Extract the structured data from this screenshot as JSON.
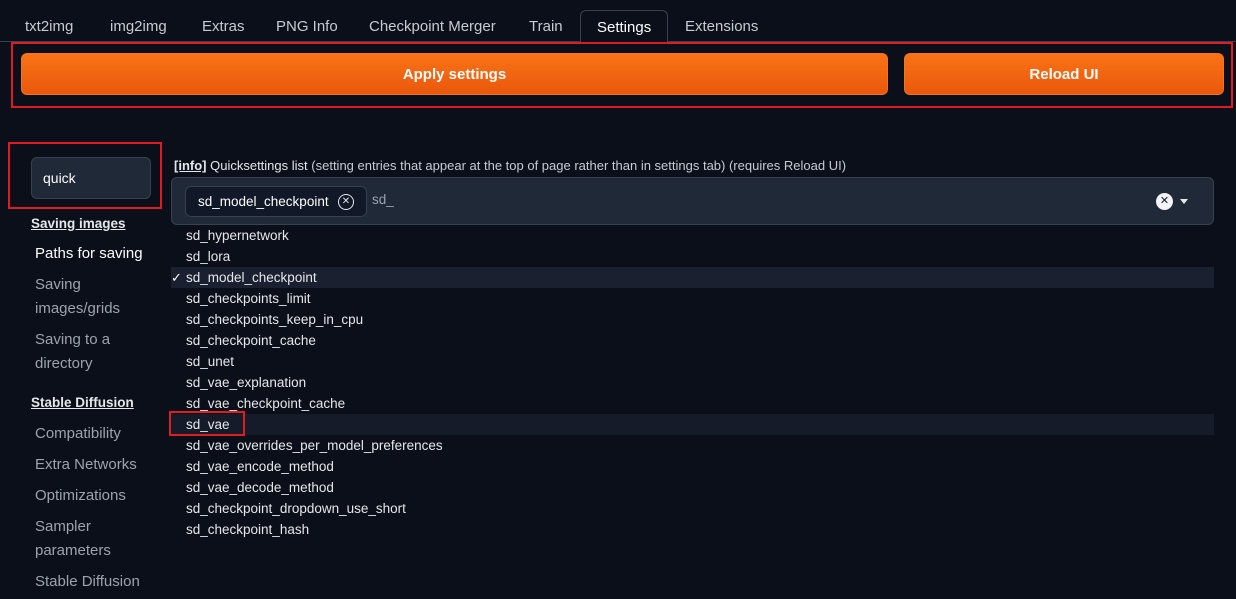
{
  "tabs": [
    "txt2img",
    "img2img",
    "Extras",
    "PNG Info",
    "Checkpoint Merger",
    "Train",
    "Settings",
    "Extensions"
  ],
  "active_tab": "Settings",
  "actions": {
    "apply": "Apply settings",
    "reload": "Reload UI"
  },
  "search": {
    "value": "quick"
  },
  "sidebar": {
    "saving_heading": "Saving images",
    "saving_items": [
      "Paths for saving",
      "Saving images/grids",
      "Saving to a directory"
    ],
    "sd_heading": "Stable Diffusion",
    "sd_items": [
      "Compatibility",
      "Extra Networks",
      "Optimizations",
      "Sampler parameters",
      "Stable Diffusion"
    ]
  },
  "setting": {
    "info_tag": "[info]",
    "label": "Quicksettings list",
    "description": " (setting entries that appear at the top of page rather than in settings tab) (requires Reload UI)",
    "chip": "sd_model_checkpoint",
    "input_value": "sd_",
    "options": [
      "sd_hypernetwork",
      "sd_lora",
      "sd_model_checkpoint",
      "sd_checkpoints_limit",
      "sd_checkpoints_keep_in_cpu",
      "sd_checkpoint_cache",
      "sd_unet",
      "sd_vae_explanation",
      "sd_vae_checkpoint_cache",
      "sd_vae",
      "sd_vae_overrides_per_model_preferences",
      "sd_vae_encode_method",
      "sd_vae_decode_method",
      "sd_checkpoint_dropdown_use_short",
      "sd_checkpoint_hash"
    ],
    "selected_option": "sd_model_checkpoint",
    "highlighted_option": "sd_vae"
  },
  "colors": {
    "accent": "#f97316",
    "annotation": "#e01b24",
    "background": "#0b0f19"
  }
}
